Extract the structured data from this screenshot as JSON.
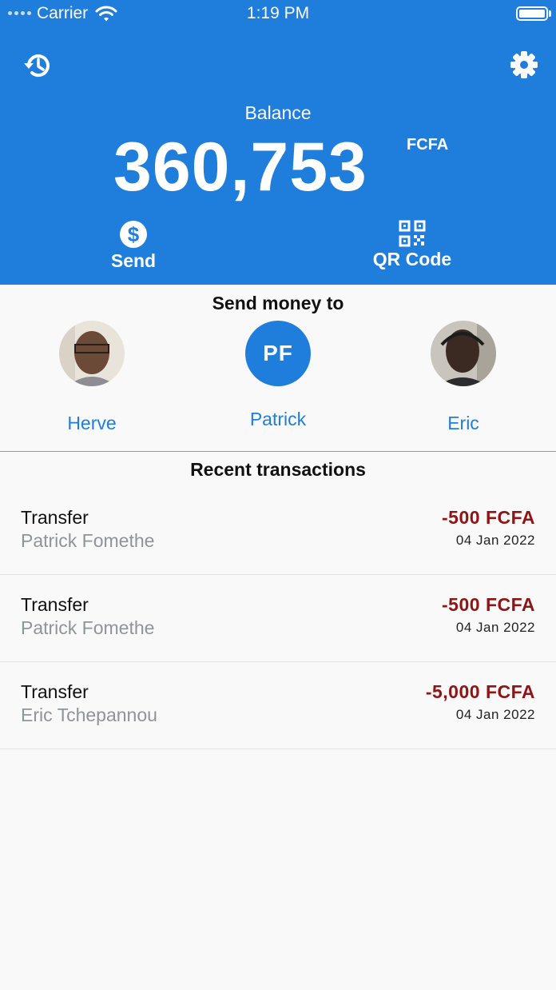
{
  "status_bar": {
    "carrier": "Carrier",
    "time": "1:19 PM"
  },
  "header": {
    "history_icon": "history-icon",
    "settings_icon": "gear-icon",
    "balance_label": "Balance",
    "balance_amount": "360,753",
    "balance_currency": "FCFA",
    "actions": [
      {
        "label": "Send",
        "icon": "dollar-circle-icon"
      },
      {
        "label": "QR Code",
        "icon": "qr-code-icon"
      }
    ],
    "background_color": "#1f7ddc"
  },
  "send_money": {
    "title": "Send money to",
    "contacts": [
      {
        "name": "Herve",
        "avatar": "photo"
      },
      {
        "name": "Patrick",
        "initials": "PF"
      },
      {
        "name": "Eric",
        "avatar": "photo"
      }
    ]
  },
  "recent": {
    "title": "Recent transactions",
    "transactions": [
      {
        "type": "Transfer",
        "party": "Patrick Fomethe",
        "amount": "-500 FCFA",
        "date": "04 Jan 2022"
      },
      {
        "type": "Transfer",
        "party": "Patrick Fomethe",
        "amount": "-500 FCFA",
        "date": "04 Jan 2022"
      },
      {
        "type": "Transfer",
        "party": "Eric Tchepannou",
        "amount": "-5,000 FCFA",
        "date": "04 Jan 2022"
      }
    ],
    "amount_color": "#8f1515"
  }
}
